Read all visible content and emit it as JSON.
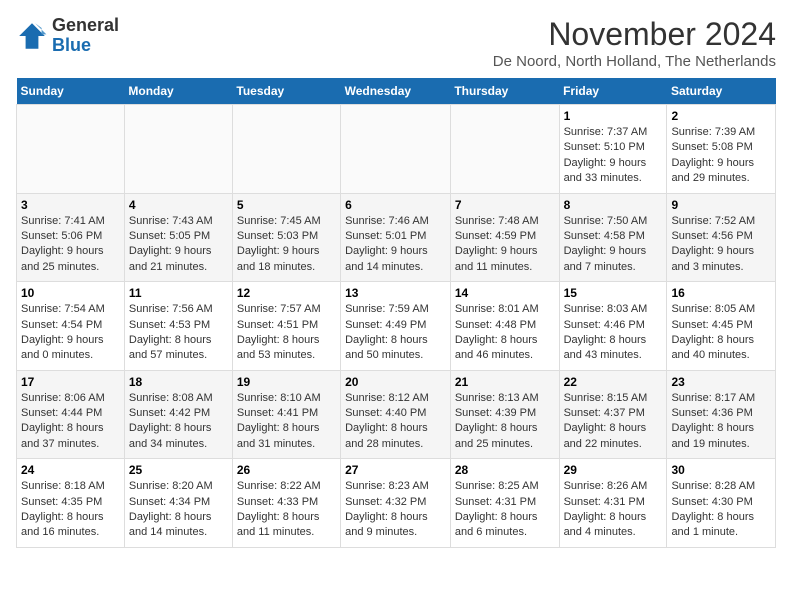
{
  "logo": {
    "general": "General",
    "blue": "Blue"
  },
  "header": {
    "title": "November 2024",
    "location": "De Noord, North Holland, The Netherlands"
  },
  "weekdays": [
    "Sunday",
    "Monday",
    "Tuesday",
    "Wednesday",
    "Thursday",
    "Friday",
    "Saturday"
  ],
  "weeks": [
    [
      {
        "day": "",
        "info": ""
      },
      {
        "day": "",
        "info": ""
      },
      {
        "day": "",
        "info": ""
      },
      {
        "day": "",
        "info": ""
      },
      {
        "day": "",
        "info": ""
      },
      {
        "day": "1",
        "info": "Sunrise: 7:37 AM\nSunset: 5:10 PM\nDaylight: 9 hours and 33 minutes."
      },
      {
        "day": "2",
        "info": "Sunrise: 7:39 AM\nSunset: 5:08 PM\nDaylight: 9 hours and 29 minutes."
      }
    ],
    [
      {
        "day": "3",
        "info": "Sunrise: 7:41 AM\nSunset: 5:06 PM\nDaylight: 9 hours and 25 minutes."
      },
      {
        "day": "4",
        "info": "Sunrise: 7:43 AM\nSunset: 5:05 PM\nDaylight: 9 hours and 21 minutes."
      },
      {
        "day": "5",
        "info": "Sunrise: 7:45 AM\nSunset: 5:03 PM\nDaylight: 9 hours and 18 minutes."
      },
      {
        "day": "6",
        "info": "Sunrise: 7:46 AM\nSunset: 5:01 PM\nDaylight: 9 hours and 14 minutes."
      },
      {
        "day": "7",
        "info": "Sunrise: 7:48 AM\nSunset: 4:59 PM\nDaylight: 9 hours and 11 minutes."
      },
      {
        "day": "8",
        "info": "Sunrise: 7:50 AM\nSunset: 4:58 PM\nDaylight: 9 hours and 7 minutes."
      },
      {
        "day": "9",
        "info": "Sunrise: 7:52 AM\nSunset: 4:56 PM\nDaylight: 9 hours and 3 minutes."
      }
    ],
    [
      {
        "day": "10",
        "info": "Sunrise: 7:54 AM\nSunset: 4:54 PM\nDaylight: 9 hours and 0 minutes."
      },
      {
        "day": "11",
        "info": "Sunrise: 7:56 AM\nSunset: 4:53 PM\nDaylight: 8 hours and 57 minutes."
      },
      {
        "day": "12",
        "info": "Sunrise: 7:57 AM\nSunset: 4:51 PM\nDaylight: 8 hours and 53 minutes."
      },
      {
        "day": "13",
        "info": "Sunrise: 7:59 AM\nSunset: 4:49 PM\nDaylight: 8 hours and 50 minutes."
      },
      {
        "day": "14",
        "info": "Sunrise: 8:01 AM\nSunset: 4:48 PM\nDaylight: 8 hours and 46 minutes."
      },
      {
        "day": "15",
        "info": "Sunrise: 8:03 AM\nSunset: 4:46 PM\nDaylight: 8 hours and 43 minutes."
      },
      {
        "day": "16",
        "info": "Sunrise: 8:05 AM\nSunset: 4:45 PM\nDaylight: 8 hours and 40 minutes."
      }
    ],
    [
      {
        "day": "17",
        "info": "Sunrise: 8:06 AM\nSunset: 4:44 PM\nDaylight: 8 hours and 37 minutes."
      },
      {
        "day": "18",
        "info": "Sunrise: 8:08 AM\nSunset: 4:42 PM\nDaylight: 8 hours and 34 minutes."
      },
      {
        "day": "19",
        "info": "Sunrise: 8:10 AM\nSunset: 4:41 PM\nDaylight: 8 hours and 31 minutes."
      },
      {
        "day": "20",
        "info": "Sunrise: 8:12 AM\nSunset: 4:40 PM\nDaylight: 8 hours and 28 minutes."
      },
      {
        "day": "21",
        "info": "Sunrise: 8:13 AM\nSunset: 4:39 PM\nDaylight: 8 hours and 25 minutes."
      },
      {
        "day": "22",
        "info": "Sunrise: 8:15 AM\nSunset: 4:37 PM\nDaylight: 8 hours and 22 minutes."
      },
      {
        "day": "23",
        "info": "Sunrise: 8:17 AM\nSunset: 4:36 PM\nDaylight: 8 hours and 19 minutes."
      }
    ],
    [
      {
        "day": "24",
        "info": "Sunrise: 8:18 AM\nSunset: 4:35 PM\nDaylight: 8 hours and 16 minutes."
      },
      {
        "day": "25",
        "info": "Sunrise: 8:20 AM\nSunset: 4:34 PM\nDaylight: 8 hours and 14 minutes."
      },
      {
        "day": "26",
        "info": "Sunrise: 8:22 AM\nSunset: 4:33 PM\nDaylight: 8 hours and 11 minutes."
      },
      {
        "day": "27",
        "info": "Sunrise: 8:23 AM\nSunset: 4:32 PM\nDaylight: 8 hours and 9 minutes."
      },
      {
        "day": "28",
        "info": "Sunrise: 8:25 AM\nSunset: 4:31 PM\nDaylight: 8 hours and 6 minutes."
      },
      {
        "day": "29",
        "info": "Sunrise: 8:26 AM\nSunset: 4:31 PM\nDaylight: 8 hours and 4 minutes."
      },
      {
        "day": "30",
        "info": "Sunrise: 8:28 AM\nSunset: 4:30 PM\nDaylight: 8 hours and 1 minute."
      }
    ]
  ]
}
